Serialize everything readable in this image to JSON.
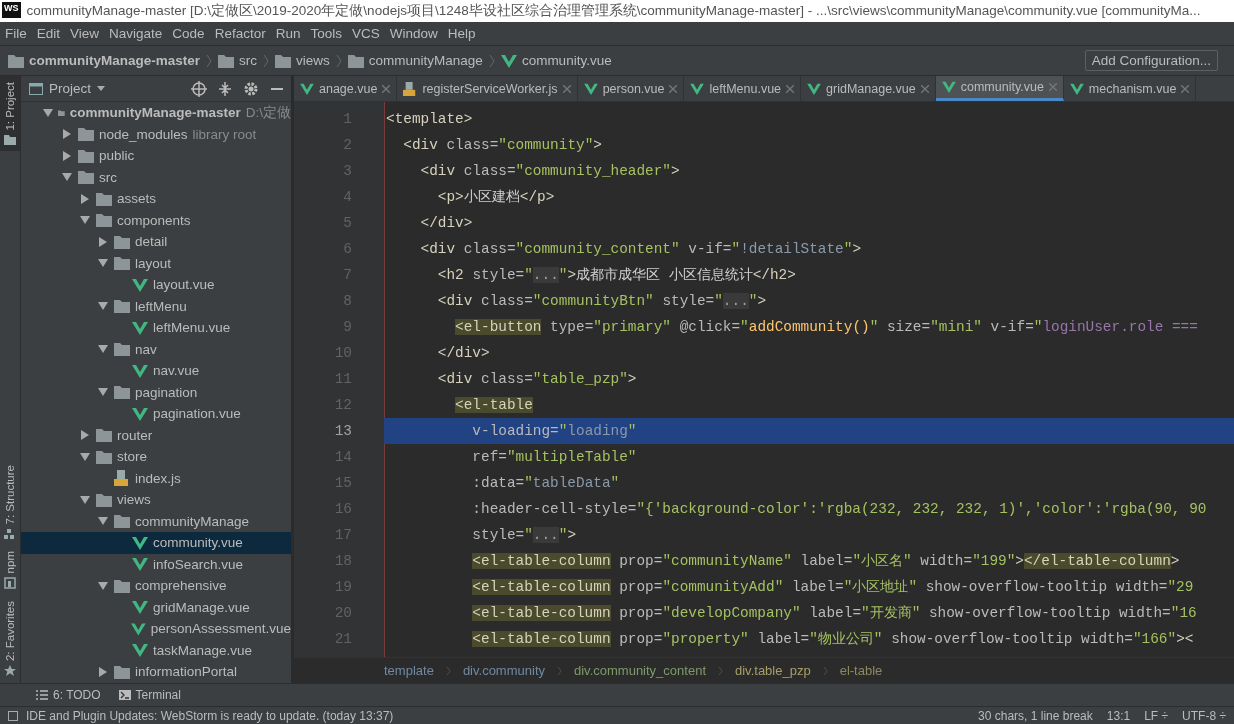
{
  "window": {
    "logo": "WS",
    "title": "communityManage-master [D:\\定做区\\2019-2020年定做\\nodejs项目\\1248毕设社区综合治理管理系统\\communityManage-master] - ...\\src\\views\\communityManage\\community.vue [communityMa..."
  },
  "menu": [
    "File",
    "Edit",
    "View",
    "Navigate",
    "Code",
    "Refactor",
    "Run",
    "Tools",
    "VCS",
    "Window",
    "Help"
  ],
  "nav_path": [
    {
      "label": "communityManage-master",
      "kind": "folder"
    },
    {
      "label": "src",
      "kind": "folder"
    },
    {
      "label": "views",
      "kind": "folder"
    },
    {
      "label": "communityManage",
      "kind": "folder"
    },
    {
      "label": "community.vue",
      "kind": "vue"
    }
  ],
  "run_config_button": "Add Configuration...",
  "tool_strip": [
    {
      "label": "1: Project",
      "kind": "project",
      "selected": true
    },
    {
      "label": "7: Structure",
      "kind": "structure",
      "selected": false
    },
    {
      "label": "npm",
      "kind": "npm",
      "selected": false
    },
    {
      "label": "2: Favorites",
      "kind": "favorites",
      "selected": false
    }
  ],
  "project": {
    "title": "Project",
    "tree": [
      {
        "name": "communityManage-master",
        "hint": "D:\\定做",
        "kind": "folder",
        "expanded": true,
        "selected": false,
        "children": [
          {
            "name": "node_modules",
            "hint": "library root",
            "kind": "folder",
            "expanded": false,
            "selected": false
          },
          {
            "name": "public",
            "kind": "folder",
            "expanded": false,
            "selected": false
          },
          {
            "name": "src",
            "kind": "folder",
            "expanded": true,
            "selected": false,
            "children": [
              {
                "name": "assets",
                "kind": "folder",
                "expanded": false,
                "selected": false
              },
              {
                "name": "components",
                "kind": "folder",
                "expanded": true,
                "selected": false,
                "children": [
                  {
                    "name": "detail",
                    "kind": "folder",
                    "expanded": false,
                    "selected": false
                  },
                  {
                    "name": "layout",
                    "kind": "folder",
                    "expanded": true,
                    "selected": false,
                    "children": [
                      {
                        "name": "layout.vue",
                        "kind": "vue",
                        "selected": false
                      }
                    ]
                  },
                  {
                    "name": "leftMenu",
                    "kind": "folder",
                    "expanded": true,
                    "selected": false,
                    "children": [
                      {
                        "name": "leftMenu.vue",
                        "kind": "vue",
                        "selected": false
                      }
                    ]
                  },
                  {
                    "name": "nav",
                    "kind": "folder",
                    "expanded": true,
                    "selected": false,
                    "children": [
                      {
                        "name": "nav.vue",
                        "kind": "vue",
                        "selected": false
                      }
                    ]
                  },
                  {
                    "name": "pagination",
                    "kind": "folder",
                    "expanded": true,
                    "selected": false,
                    "children": [
                      {
                        "name": "pagination.vue",
                        "kind": "vue",
                        "selected": false
                      }
                    ]
                  }
                ]
              },
              {
                "name": "router",
                "kind": "folder",
                "expanded": false,
                "selected": false
              },
              {
                "name": "store",
                "kind": "folder",
                "expanded": true,
                "selected": false,
                "children": [
                  {
                    "name": "index.js",
                    "kind": "js",
                    "selected": false
                  }
                ]
              },
              {
                "name": "views",
                "kind": "folder",
                "expanded": true,
                "selected": false,
                "children": [
                  {
                    "name": "communityManage",
                    "kind": "folder",
                    "expanded": true,
                    "selected": false,
                    "children": [
                      {
                        "name": "community.vue",
                        "kind": "vue",
                        "selected": true
                      },
                      {
                        "name": "infoSearch.vue",
                        "kind": "vue",
                        "selected": false
                      }
                    ]
                  },
                  {
                    "name": "comprehensive",
                    "kind": "folder",
                    "expanded": true,
                    "selected": false,
                    "children": [
                      {
                        "name": "gridManage.vue",
                        "kind": "vue",
                        "selected": false
                      },
                      {
                        "name": "personAssessment.vue",
                        "kind": "vue",
                        "selected": false
                      },
                      {
                        "name": "taskManage.vue",
                        "kind": "vue",
                        "selected": false
                      }
                    ]
                  },
                  {
                    "name": "informationPortal",
                    "kind": "folder",
                    "expanded": false,
                    "selected": false
                  }
                ]
              }
            ]
          }
        ]
      }
    ]
  },
  "editor_tabs": [
    {
      "label": "anage.vue",
      "kind": "vue",
      "selected": false
    },
    {
      "label": "registerServiceWorker.js",
      "kind": "js",
      "selected": false
    },
    {
      "label": "person.vue",
      "kind": "vue",
      "selected": false
    },
    {
      "label": "leftMenu.vue",
      "kind": "vue",
      "selected": false
    },
    {
      "label": "gridManage.vue",
      "kind": "vue",
      "selected": false
    },
    {
      "label": "community.vue",
      "kind": "vue",
      "selected": true
    },
    {
      "label": "mechanism.vue",
      "kind": "vue",
      "selected": false
    }
  ],
  "code": [
    {
      "number": "1",
      "selected": false,
      "tokens": [
        {
          "kind": "tag",
          "text": "<template>"
        }
      ]
    },
    {
      "number": "2",
      "selected": false,
      "tokens": [
        {
          "kind": "tag",
          "text": "  <div"
        },
        {
          "kind": "attr",
          "text": " class="
        },
        {
          "kind": "str",
          "text": "\"community\""
        },
        {
          "kind": "tag",
          "text": ">"
        }
      ]
    },
    {
      "number": "3",
      "selected": false,
      "tokens": [
        {
          "kind": "tag",
          "text": "    <div"
        },
        {
          "kind": "attr",
          "text": " class="
        },
        {
          "kind": "str",
          "text": "\"community_header\""
        },
        {
          "kind": "tag",
          "text": ">"
        }
      ]
    },
    {
      "number": "4",
      "selected": false,
      "tokens": [
        {
          "kind": "tag",
          "text": "      <p>"
        },
        {
          "kind": "plain",
          "text": "小区建档"
        },
        {
          "kind": "tag",
          "text": "</p>"
        }
      ]
    },
    {
      "number": "5",
      "selected": false,
      "tokens": [
        {
          "kind": "tag",
          "text": "    </div>"
        }
      ]
    },
    {
      "number": "6",
      "selected": false,
      "tokens": [
        {
          "kind": "tag",
          "text": "    <div"
        },
        {
          "kind": "attr",
          "text": " class="
        },
        {
          "kind": "str",
          "text": "\"community_content\""
        },
        {
          "kind": "attr",
          "text": " v-if="
        },
        {
          "kind": "str",
          "text": "\""
        },
        {
          "kind": "expr",
          "text": "!detailState"
        },
        {
          "kind": "str",
          "text": "\""
        },
        {
          "kind": "tag",
          "text": ">"
        }
      ]
    },
    {
      "number": "7",
      "selected": false,
      "tokens": [
        {
          "kind": "tag",
          "text": "      <h2"
        },
        {
          "kind": "attr",
          "text": " style="
        },
        {
          "kind": "str",
          "text": "\""
        },
        {
          "kind": "fold",
          "text": "..."
        },
        {
          "kind": "str",
          "text": "\""
        },
        {
          "kind": "tag",
          "text": ">"
        },
        {
          "kind": "plain",
          "text": "成都市成华区 小区信息统计"
        },
        {
          "kind": "tag",
          "text": "</h2>"
        }
      ]
    },
    {
      "number": "8",
      "selected": false,
      "tokens": [
        {
          "kind": "tag",
          "text": "      <div"
        },
        {
          "kind": "attr",
          "text": " class="
        },
        {
          "kind": "str",
          "text": "\"communityBtn\""
        },
        {
          "kind": "attr",
          "text": " style="
        },
        {
          "kind": "str",
          "text": "\""
        },
        {
          "kind": "fold",
          "text": "..."
        },
        {
          "kind": "str",
          "text": "\""
        },
        {
          "kind": "tag",
          "text": ">"
        }
      ]
    },
    {
      "number": "9",
      "selected": false,
      "tokens": [
        {
          "kind": "hltag",
          "text": "        <el-button"
        },
        {
          "kind": "attr",
          "text": " type="
        },
        {
          "kind": "str",
          "text": "\"primary\""
        },
        {
          "kind": "attr",
          "text": " @click="
        },
        {
          "kind": "str",
          "text": "\""
        },
        {
          "kind": "fn",
          "text": "addCommunity()"
        },
        {
          "kind": "str",
          "text": "\""
        },
        {
          "kind": "attr",
          "text": " size="
        },
        {
          "kind": "str",
          "text": "\"mini\""
        },
        {
          "kind": "attr",
          "text": " v-if="
        },
        {
          "kind": "str",
          "text": "\""
        },
        {
          "kind": "var",
          "text": "loginUser.role ==="
        }
      ]
    },
    {
      "number": "10",
      "selected": false,
      "tokens": [
        {
          "kind": "tag",
          "text": "      </div>"
        }
      ]
    },
    {
      "number": "11",
      "selected": false,
      "tokens": [
        {
          "kind": "tag",
          "text": "      <div"
        },
        {
          "kind": "attr",
          "text": " class="
        },
        {
          "kind": "str",
          "text": "\"table_pzp\""
        },
        {
          "kind": "tag",
          "text": ">"
        }
      ]
    },
    {
      "number": "12",
      "selected": false,
      "tokens": [
        {
          "kind": "hltag",
          "text": "        <el-table"
        }
      ]
    },
    {
      "number": "13",
      "selected": true,
      "tokens": [
        {
          "kind": "attr",
          "text": "          v-loading="
        },
        {
          "kind": "str",
          "text": "\""
        },
        {
          "kind": "expr",
          "text": "loading"
        },
        {
          "kind": "str",
          "text": "\""
        }
      ]
    },
    {
      "number": "14",
      "selected": false,
      "tokens": [
        {
          "kind": "attr",
          "text": "          ref="
        },
        {
          "kind": "str",
          "text": "\"multipleTable\""
        }
      ]
    },
    {
      "number": "15",
      "selected": false,
      "tokens": [
        {
          "kind": "attr",
          "text": "          :data="
        },
        {
          "kind": "str",
          "text": "\""
        },
        {
          "kind": "expr",
          "text": "tableData"
        },
        {
          "kind": "str",
          "text": "\""
        }
      ]
    },
    {
      "number": "16",
      "selected": false,
      "tokens": [
        {
          "kind": "attr",
          "text": "          :header-cell-style="
        },
        {
          "kind": "str",
          "text": "\"{'background-color':'rgba(232, 232, 232, 1)','color':'rgba(90, 90"
        }
      ]
    },
    {
      "number": "17",
      "selected": false,
      "tokens": [
        {
          "kind": "attr",
          "text": "          style="
        },
        {
          "kind": "str",
          "text": "\""
        },
        {
          "kind": "fold",
          "text": "..."
        },
        {
          "kind": "str",
          "text": "\""
        },
        {
          "kind": "tag",
          "text": ">"
        }
      ]
    },
    {
      "number": "18",
      "selected": false,
      "tokens": [
        {
          "kind": "hltag",
          "text": "          <el-table-column"
        },
        {
          "kind": "attr",
          "text": " prop="
        },
        {
          "kind": "str",
          "text": "\"communityName\""
        },
        {
          "kind": "attr",
          "text": " label="
        },
        {
          "kind": "str",
          "text": "\"小区名\""
        },
        {
          "kind": "attr",
          "text": " width="
        },
        {
          "kind": "str",
          "text": "\"199\""
        },
        {
          "kind": "tag",
          "text": ">"
        },
        {
          "kind": "hltag",
          "text": "</el-table-column"
        },
        {
          "kind": "tag",
          "text": ">"
        }
      ]
    },
    {
      "number": "19",
      "selected": false,
      "tokens": [
        {
          "kind": "hltag",
          "text": "          <el-table-column"
        },
        {
          "kind": "attr",
          "text": " prop="
        },
        {
          "kind": "str",
          "text": "\"communityAdd\""
        },
        {
          "kind": "attr",
          "text": " label="
        },
        {
          "kind": "str",
          "text": "\"小区地址\""
        },
        {
          "kind": "attr",
          "text": " show-overflow-tooltip width="
        },
        {
          "kind": "str",
          "text": "\"29"
        }
      ]
    },
    {
      "number": "20",
      "selected": false,
      "tokens": [
        {
          "kind": "hltag",
          "text": "          <el-table-column"
        },
        {
          "kind": "attr",
          "text": " prop="
        },
        {
          "kind": "str",
          "text": "\"developCompany\""
        },
        {
          "kind": "attr",
          "text": " label="
        },
        {
          "kind": "str",
          "text": "\"开发商\""
        },
        {
          "kind": "attr",
          "text": " show-overflow-tooltip width="
        },
        {
          "kind": "str",
          "text": "\"16"
        }
      ]
    },
    {
      "number": "21",
      "selected": false,
      "tokens": [
        {
          "kind": "hltag",
          "text": "          <el-table-column"
        },
        {
          "kind": "attr",
          "text": " prop="
        },
        {
          "kind": "str",
          "text": "\"property\""
        },
        {
          "kind": "attr",
          "text": " label="
        },
        {
          "kind": "str",
          "text": "\"物业公司\""
        },
        {
          "kind": "attr",
          "text": " show-overflow-tooltip width="
        },
        {
          "kind": "str",
          "text": "\"166\""
        },
        {
          "kind": "tag",
          "text": "><"
        }
      ]
    }
  ],
  "code_breadcrumb": [
    {
      "label": "template",
      "color": "#6f8aa3"
    },
    {
      "label": "div.community",
      "color": "#6f8aa3"
    },
    {
      "label": "div.community_content",
      "color": "#7f9a6a"
    },
    {
      "label": "div.table_pzp",
      "color": "#a89f68"
    },
    {
      "label": "el-table",
      "color": "#8c8a5c"
    }
  ],
  "bottom_tools": [
    {
      "label": "6: TODO",
      "kind": "todo"
    },
    {
      "label": "Terminal",
      "kind": "terminal"
    }
  ],
  "status_bar": {
    "message": "IDE and Plugin Updates: WebStorm is ready to update. (today 13:37)",
    "selection": "30 chars, 1 line break",
    "position": "13:1",
    "line_separator": "LF ÷",
    "encoding": "UTF-8 ÷"
  }
}
